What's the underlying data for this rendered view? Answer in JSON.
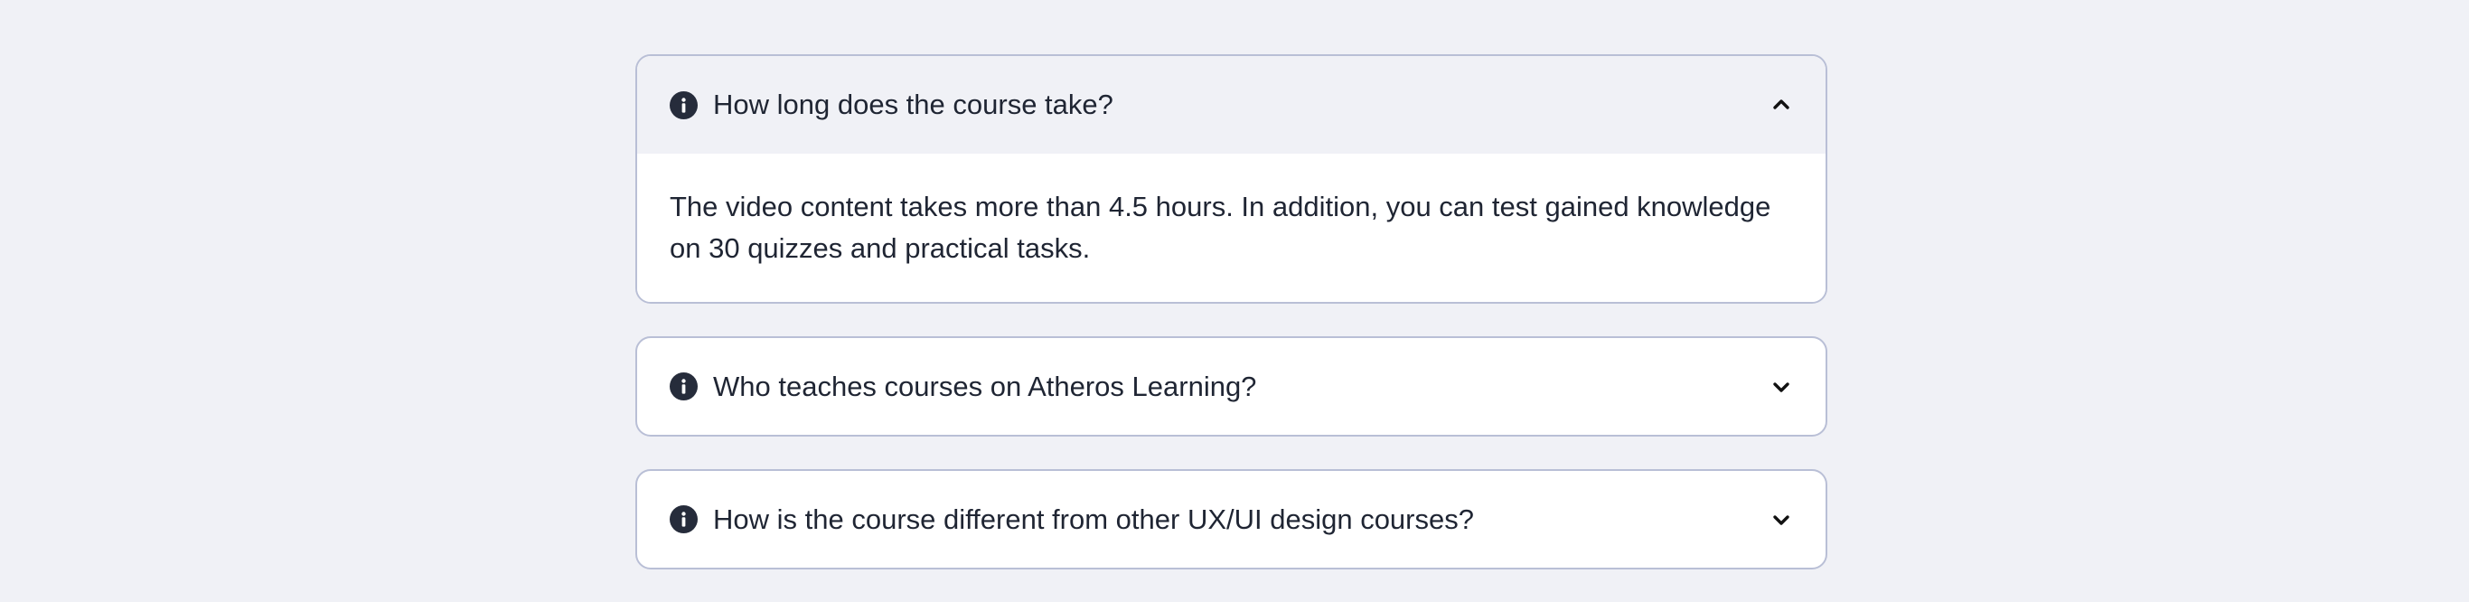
{
  "faq": {
    "items": [
      {
        "question": "How long does the course take?",
        "answer": "The video content takes more than 4.5 hours. In addition, you can test gained knowledge on 30 quizzes and practical tasks.",
        "expanded": true,
        "icon": "info-icon",
        "toggle_icon": "chevron-up-icon"
      },
      {
        "question": "Who teaches courses on Atheros Learning?",
        "expanded": false,
        "icon": "info-icon",
        "toggle_icon": "chevron-down-icon"
      },
      {
        "question": "How is the course different from other UX/UI design courses?",
        "expanded": false,
        "icon": "info-icon",
        "toggle_icon": "chevron-down-icon"
      }
    ]
  },
  "colors": {
    "page_background": "#f0f1f6",
    "card_background": "#ffffff",
    "card_border": "#b9bfd6",
    "text": "#1f2533",
    "icon": "#262c3b"
  }
}
